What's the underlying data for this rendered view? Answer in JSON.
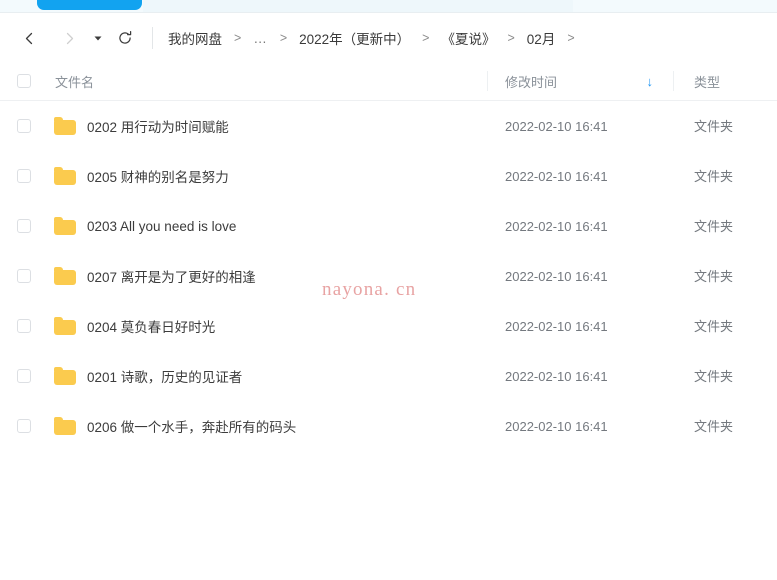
{
  "window": {
    "top_bar": {
      "primary_button_label": "",
      "primary_button_color": "#12a3f0"
    }
  },
  "navbar": {
    "back_icon": "chevron-left-icon",
    "forward_icon": "chevron-right-icon",
    "history_caret_icon": "caret-down-icon",
    "reload_icon": "refresh-icon",
    "breadcrumb": [
      {
        "label": "我的网盘",
        "type": "crumb"
      },
      {
        "label": ">",
        "type": "sep"
      },
      {
        "label": "…",
        "type": "ellipsis"
      },
      {
        "label": ">",
        "type": "sep"
      },
      {
        "label": "2022年（更新中）",
        "type": "crumb"
      },
      {
        "label": ">",
        "type": "sep"
      },
      {
        "label": "《夏说》",
        "type": "crumb"
      },
      {
        "label": ">",
        "type": "sep"
      },
      {
        "label": "02月",
        "type": "crumb"
      },
      {
        "label": ">",
        "type": "sep"
      }
    ]
  },
  "table": {
    "columns": {
      "name": "文件名",
      "modified": "修改时间",
      "type": "类型"
    },
    "sort": {
      "column": "修改时间",
      "direction": "desc",
      "arrow_glyph": "↓",
      "arrow_color": "#2196f3"
    },
    "select_all_checked": false,
    "rows": [
      {
        "name": "0202 用行动为时间赋能",
        "modified": "2022-02-10 16:41",
        "type": "文件夹",
        "icon": "folder-icon",
        "checked": false
      },
      {
        "name": "0205 财神的别名是努力",
        "modified": "2022-02-10 16:41",
        "type": "文件夹",
        "icon": "folder-icon",
        "checked": false
      },
      {
        "name": "0203 All you need is love",
        "modified": "2022-02-10 16:41",
        "type": "文件夹",
        "icon": "folder-icon",
        "checked": false
      },
      {
        "name": "0207 离开是为了更好的相逢",
        "modified": "2022-02-10 16:41",
        "type": "文件夹",
        "icon": "folder-icon",
        "checked": false
      },
      {
        "name": "0204  莫负春日好时光",
        "modified": "2022-02-10 16:41",
        "type": "文件夹",
        "icon": "folder-icon",
        "checked": false
      },
      {
        "name": "0201 诗歌，历史的见证者",
        "modified": "2022-02-10 16:41",
        "type": "文件夹",
        "icon": "folder-icon",
        "checked": false
      },
      {
        "name": "0206 做一个水手，奔赴所有的码头",
        "modified": "2022-02-10 16:41",
        "type": "文件夹",
        "icon": "folder-icon",
        "checked": false
      }
    ]
  },
  "watermark": {
    "text": "nayona. cn",
    "color": "#e8a3a3"
  }
}
